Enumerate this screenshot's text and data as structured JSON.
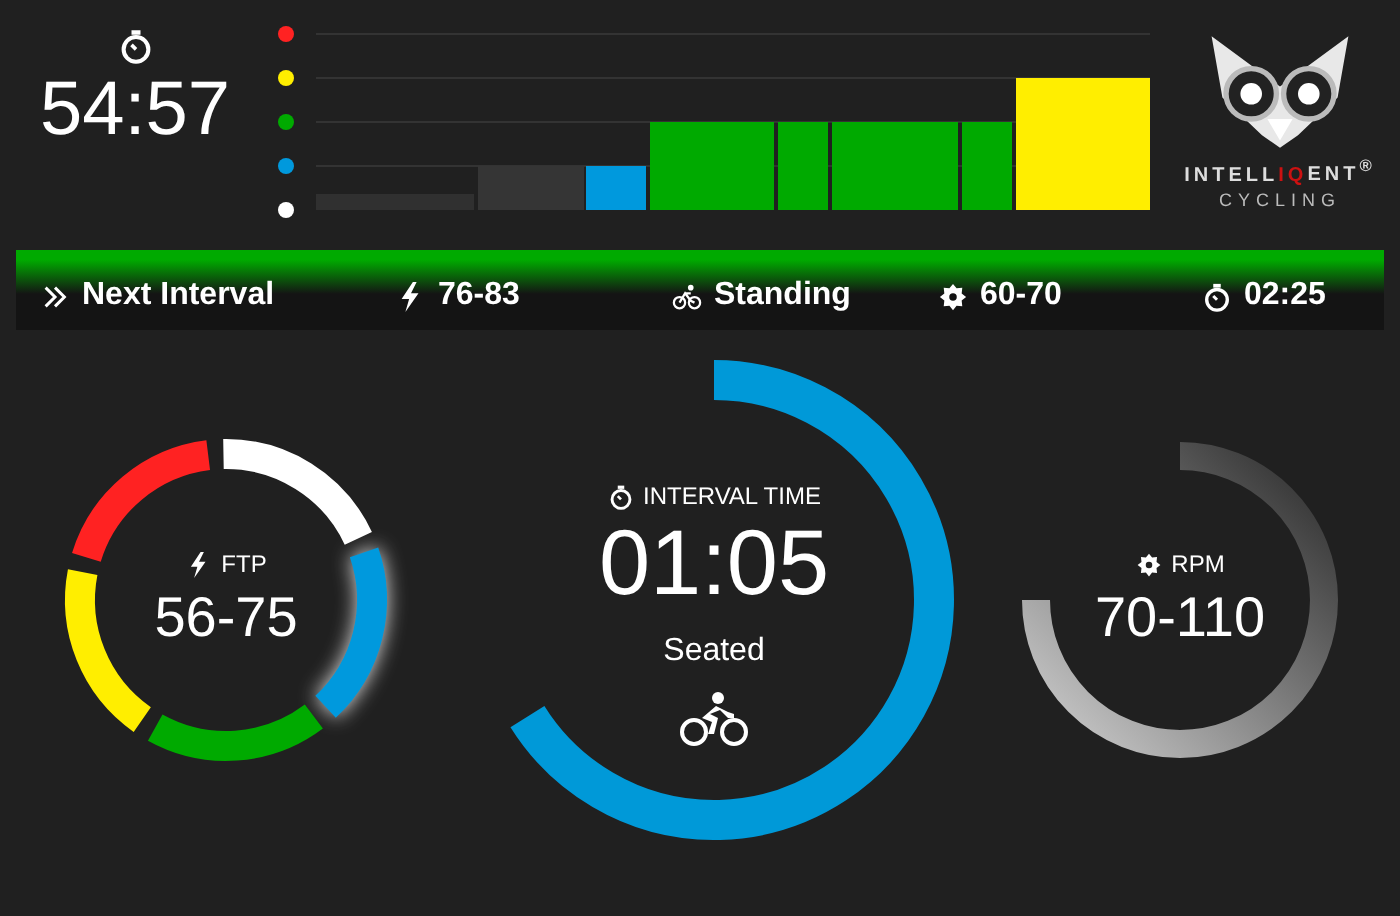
{
  "elapsed": {
    "time": "54:57"
  },
  "zones": [
    {
      "color": "#ff2222"
    },
    {
      "color": "#ffee00"
    },
    {
      "color": "#00aa00"
    },
    {
      "color": "#0099dd"
    },
    {
      "color": "#ffffff"
    }
  ],
  "logo": {
    "wordmark": [
      {
        "text": "INTELL",
        "accent": false
      },
      {
        "text": "IQ",
        "accent": true
      },
      {
        "text": "ENT$^{®}$",
        "accent": false
      }
    ],
    "tagline": "CYCLING"
  },
  "next_interval": {
    "label": "Next Interval",
    "power": "76-83",
    "position": "Standing",
    "cadence": "60-70",
    "duration": "02:25"
  },
  "ftp": {
    "label": "FTP",
    "range": "56-75",
    "segments": [
      {
        "color": "#ffffff",
        "selected": false
      },
      {
        "color": "#0099dd",
        "selected": true
      },
      {
        "color": "#00aa00",
        "selected": false
      },
      {
        "color": "#ffee00",
        "selected": false
      },
      {
        "color": "#ff2222",
        "selected": false
      }
    ]
  },
  "interval": {
    "label": "INTERVAL TIME",
    "time": "01:05",
    "position": "Seated"
  },
  "rpm": {
    "label": "RPM",
    "range": "70-110"
  }
}
